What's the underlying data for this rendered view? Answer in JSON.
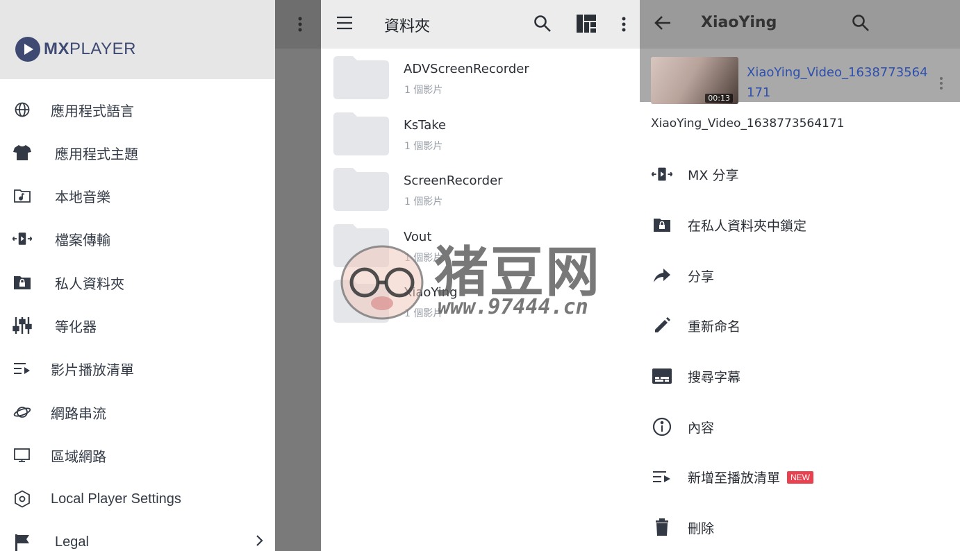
{
  "drawer": {
    "logo_text": {
      "bold": "MX",
      "normal": "PLAYER"
    },
    "items": [
      {
        "label": "應用程式語言",
        "icon": "globe-icon"
      },
      {
        "label": "應用程式主題",
        "icon": "tshirt-icon"
      },
      {
        "label": "本地音樂",
        "icon": "music-folder-icon"
      },
      {
        "label": "檔案傳輸",
        "icon": "transfer-icon"
      },
      {
        "label": "私人資料夾",
        "icon": "private-folder-icon"
      },
      {
        "label": "等化器",
        "icon": "equalizer-icon"
      },
      {
        "label": "影片播放清單",
        "icon": "playlist-icon"
      },
      {
        "label": "網路串流",
        "icon": "stream-icon"
      },
      {
        "label": "區域網路",
        "icon": "monitor-icon"
      },
      {
        "label": "Local Player Settings",
        "icon": "settings-hex-icon"
      },
      {
        "label": "Legal",
        "icon": "flag-icon"
      }
    ]
  },
  "folders": {
    "title": "資料夾",
    "items": [
      {
        "name": "ADVScreenRecorder",
        "count": "1 個影片"
      },
      {
        "name": "KsTake",
        "count": "1 個影片"
      },
      {
        "name": "ScreenRecorder",
        "count": "1 個影片"
      },
      {
        "name": "Vout",
        "count": "1 個影片"
      },
      {
        "name": "XiaoYing",
        "count": "1 個影片"
      }
    ]
  },
  "detail": {
    "title": "XiaoYing",
    "video_name": "XiaoYing_Video_1638773564171",
    "video_duration": "00:13",
    "sheet_filename": "XiaoYing_Video_1638773564171",
    "actions": [
      {
        "label": "MX 分享",
        "icon": "mx-share-icon"
      },
      {
        "label": "在私人資料夾中鎖定",
        "icon": "lock-folder-icon"
      },
      {
        "label": "分享",
        "icon": "share-arrow-icon"
      },
      {
        "label": "重新命名",
        "icon": "pencil-icon"
      },
      {
        "label": "搜尋字幕",
        "icon": "subtitles-icon"
      },
      {
        "label": "內容",
        "icon": "info-icon"
      },
      {
        "label": "新增至播放清單",
        "icon": "add-playlist-icon",
        "badge": "NEW"
      },
      {
        "label": "刪除",
        "icon": "trash-icon"
      }
    ]
  },
  "watermark": {
    "title": "猪豆网",
    "url": "www.97444.cn"
  },
  "colors": {
    "accent": "#3f4a73",
    "link": "#2d4fae",
    "badge": "#e8414f"
  }
}
